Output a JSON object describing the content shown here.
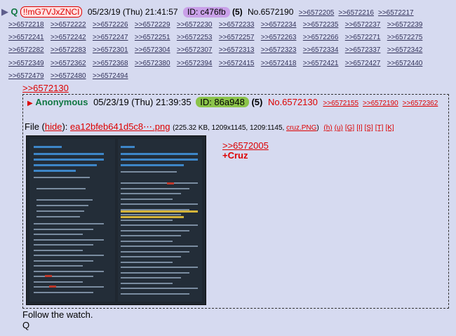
{
  "header": {
    "arrow": "▶",
    "name": "Q",
    "tripcode": "!!mG7VJxZNCI",
    "datetime": "05/23/19 (Thu) 21:41:57",
    "id": "ID: c476fb",
    "id_color": "#c9a0e8",
    "count": "(5)",
    "post_no": "No.6572190"
  },
  "replies": [
    ">>6572205",
    ">>6572216",
    ">>6572217",
    ">>6572218",
    ">>6572222",
    ">>6572226",
    ">>6572229",
    ">>6572230",
    ">>6572233",
    ">>6572234",
    ">>6572235",
    ">>6572237",
    ">>6572239",
    ">>6572241",
    ">>6572242",
    ">>6572247",
    ">>6572251",
    ">>6572253",
    ">>6572257",
    ">>6572263",
    ">>6572266",
    ">>6572271",
    ">>6572275",
    ">>6572282",
    ">>6572283",
    ">>6572301",
    ">>6572304",
    ">>6572307",
    ">>6572313",
    ">>6572323",
    ">>6572334",
    ">>6572337",
    ">>6572342",
    ">>6572349",
    ">>6572362",
    ">>6572368",
    ">>6572380",
    ">>6572394",
    ">>6572415",
    ">>6572418",
    ">>6572421",
    ">>6572427",
    ">>6572440",
    ">>6572479",
    ">>6572480",
    ">>6572494"
  ],
  "quoted_link": ">>6572130",
  "embedded": {
    "arrow": "▶",
    "name": "Anonymous",
    "datetime": "05/23/19 (Thu) 21:39:35",
    "id": "ID: 86a948",
    "id_color": "#8bc34a",
    "count": "(5)",
    "post_no": "No.6572130",
    "replies": [
      ">>6572155",
      ">>6572190",
      ">>6572362"
    ],
    "file": {
      "label": "File (",
      "hide": "hide",
      "close": "):",
      "filename": "ea12bfeb641d5c8⋯.png",
      "meta_pre": "(225.32 KB, 1209x1145, 1209:1145, ",
      "meta_link": "cruz.PNG",
      "meta_post": ")",
      "tools": [
        "(h)",
        "(u)",
        "[G]",
        "[I]",
        "[S]",
        "[T]",
        "[K]"
      ]
    },
    "side_link": ">>6572005",
    "side_text": "+Cruz"
  },
  "footer": {
    "line1": "Follow the watch.",
    "line2": "Q"
  }
}
